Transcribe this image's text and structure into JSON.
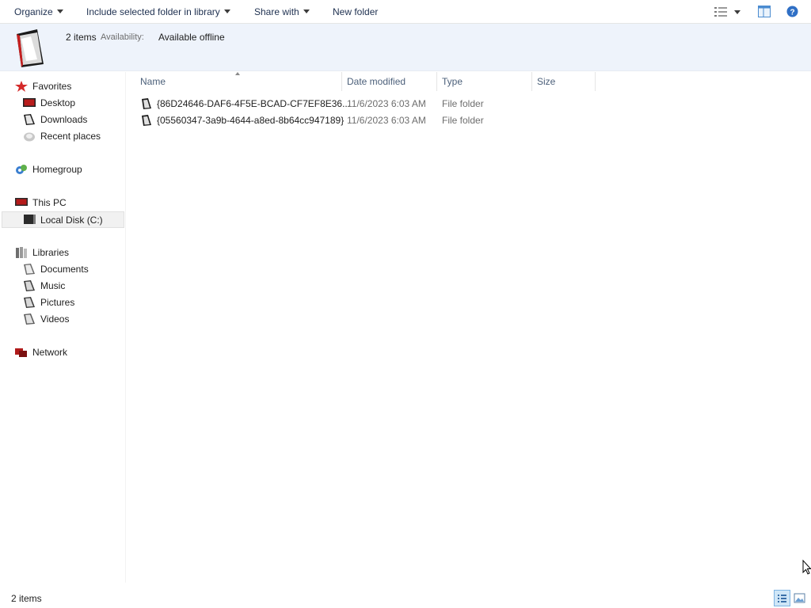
{
  "toolbar": {
    "organize": "Organize",
    "include_library": "Include selected folder in library",
    "share_with": "Share with",
    "new_folder": "New folder"
  },
  "details_pane": {
    "count": "2 items",
    "availability_label": "Availability:",
    "availability_value": "Available offline"
  },
  "nav": {
    "favorites": "Favorites",
    "desktop": "Desktop",
    "downloads": "Downloads",
    "recent_places": "Recent places",
    "homegroup": "Homegroup",
    "this_pc": "This PC",
    "local_disk": "Local Disk (C:)",
    "libraries": "Libraries",
    "documents": "Documents",
    "music": "Music",
    "pictures": "Pictures",
    "videos": "Videos",
    "network": "Network"
  },
  "columns": {
    "name": "Name",
    "date_modified": "Date modified",
    "type": "Type",
    "size": "Size"
  },
  "files": [
    {
      "name": "{86D24646-DAF6-4F5E-BCAD-CF7EF8E36...",
      "date": "11/6/2023 6:03 AM",
      "type": "File folder"
    },
    {
      "name": "{05560347-3a9b-4644-a8ed-8b64cc947189}",
      "date": "11/6/2023 6:03 AM",
      "type": "File folder"
    }
  ],
  "status_bar": {
    "count": "2 items"
  },
  "icons": {
    "star": "star-icon",
    "folder": "folder-icon",
    "drive": "drive-icon",
    "homegroup": "homegroup-icon",
    "network": "network-icon",
    "help": "help-icon"
  },
  "colors": {
    "details_bg": "#eef3fb",
    "selected_nav": "#f1f1f1",
    "accent": "#2b6fc8"
  }
}
